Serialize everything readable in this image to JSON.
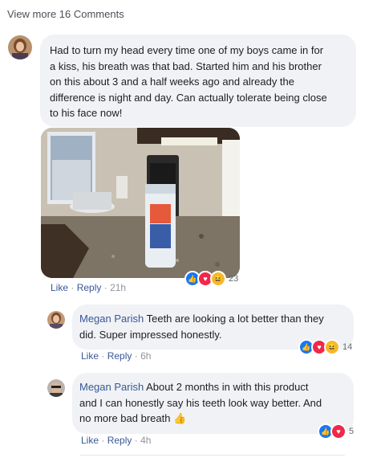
{
  "view_more": "View more 16 Comments",
  "comments": [
    {
      "text": "Had to turn my head every time one of my boys came in for a kiss, his breath was that bad. Started him and his brother on this about 3 and a half weeks ago and already the difference is night and day. Can actually tolerate being close to his face now!",
      "lines": [
        "Had to turn my head every time one of my boys came in for",
        "a kiss, his breath was that bad. Started him and his brother",
        "on this about 3 and a half weeks ago and already the",
        "difference is night and day. Can actually tolerate being close",
        "to his face now!"
      ],
      "like": "Like",
      "sep": "·",
      "reply": "Reply",
      "time": "21h",
      "reaction_count": "23"
    }
  ],
  "replies": [
    {
      "author": "Megan Parish",
      "line1": "Teeth are looking a lot better than they",
      "line2": "did. Super impressed honestly.",
      "like": "Like",
      "sep": "·",
      "reply": "Reply",
      "time": "6h",
      "reaction_count": "14"
    },
    {
      "author": "Megan Parish",
      "line1": "About 2 months in with this product",
      "line2": "and I can honestly say his teeth look way better. And",
      "line3": "no more bad breath",
      "emoji": "👍",
      "like": "Like",
      "sep": "·",
      "reply": "Reply",
      "time": "4h",
      "reaction_count": "5"
    }
  ],
  "icons": {
    "like": "like-reaction-icon",
    "love": "love-reaction-icon",
    "haha": "haha-reaction-icon"
  },
  "colors": {
    "link": "#385898",
    "bubble": "#f0f2f5",
    "like": "#1877f2",
    "love": "#f0284a",
    "haha": "#f7b928"
  }
}
